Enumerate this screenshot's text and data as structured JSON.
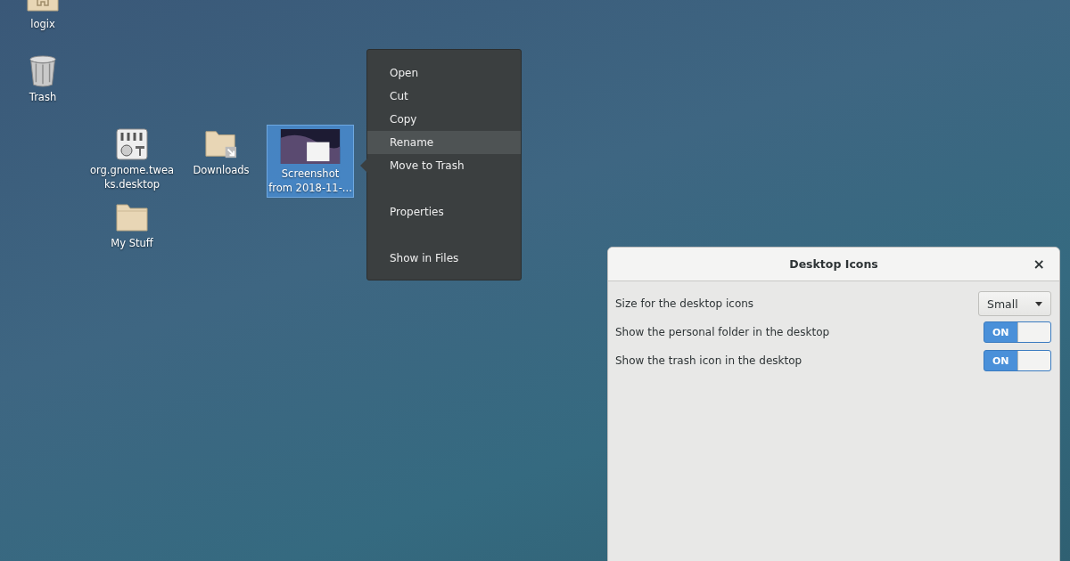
{
  "desktop": {
    "icons": [
      {
        "kind": "home",
        "label": "logix",
        "selected": false
      },
      {
        "kind": "trash",
        "label": "Trash",
        "selected": false
      },
      {
        "kind": "app",
        "label": "org.gnome.twea\nks.desktop",
        "selected": false
      },
      {
        "kind": "link-folder",
        "label": "Downloads",
        "selected": false
      },
      {
        "kind": "image",
        "label": "Screenshot\nfrom 2018-11-...",
        "selected": true
      },
      {
        "kind": "folder",
        "label": "My Stuff",
        "selected": false
      }
    ]
  },
  "context_menu": {
    "items": [
      {
        "kind": "item",
        "label": "Open",
        "selected": false
      },
      {
        "kind": "item",
        "label": "Cut",
        "selected": false
      },
      {
        "kind": "item",
        "label": "Copy",
        "selected": false
      },
      {
        "kind": "item",
        "label": "Rename",
        "selected": true
      },
      {
        "kind": "item",
        "label": "Move to Trash",
        "selected": false
      },
      {
        "kind": "separator"
      },
      {
        "kind": "item",
        "label": "Properties",
        "selected": false
      },
      {
        "kind": "separator"
      },
      {
        "kind": "item",
        "label": "Show in Files",
        "selected": false
      }
    ]
  },
  "dialog": {
    "title": "Desktop Icons",
    "close": "×",
    "settings": [
      {
        "kind": "dropdown",
        "label": "Size for the desktop icons",
        "value": "Small"
      },
      {
        "kind": "switch",
        "label": "Show the personal folder in the desktop",
        "on": true,
        "on_text": "ON"
      },
      {
        "kind": "switch",
        "label": "Show the trash icon in the desktop",
        "on": true,
        "on_text": "ON"
      }
    ]
  }
}
